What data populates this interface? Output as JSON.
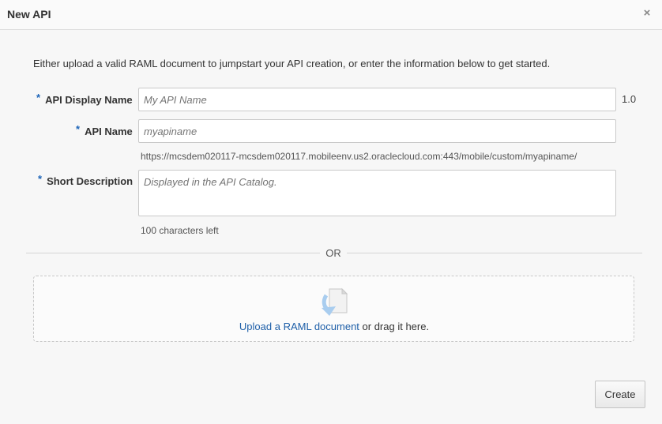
{
  "dialog": {
    "title": "New API",
    "close_glyph": "×"
  },
  "intro_text": "Either upload a valid RAML document to jumpstart your API creation, or enter the information below to get started.",
  "form": {
    "required_marker": "*",
    "display_name": {
      "label": "API Display Name",
      "placeholder": "My API Name",
      "value": "",
      "version": "1.0"
    },
    "api_name": {
      "label": "API Name",
      "placeholder": "myapiname",
      "value": "",
      "url_hint": "https://mcsdem020117-mcsdem020117.mobileenv.us2.oraclecloud.com:443/mobile/custom/myapiname/"
    },
    "short_description": {
      "label": "Short Description",
      "placeholder": "Displayed in the API Catalog.",
      "value": "",
      "chars_left": "100 characters left"
    }
  },
  "separator_text": "OR",
  "upload": {
    "icon": "document-upload-icon",
    "link_text": "Upload a RAML document",
    "suffix_text": " or drag it here."
  },
  "actions": {
    "create_label": "Create"
  },
  "colors": {
    "accent": "#1e5fa8",
    "required": "#1c64b8",
    "background": "#f7f7f7"
  }
}
